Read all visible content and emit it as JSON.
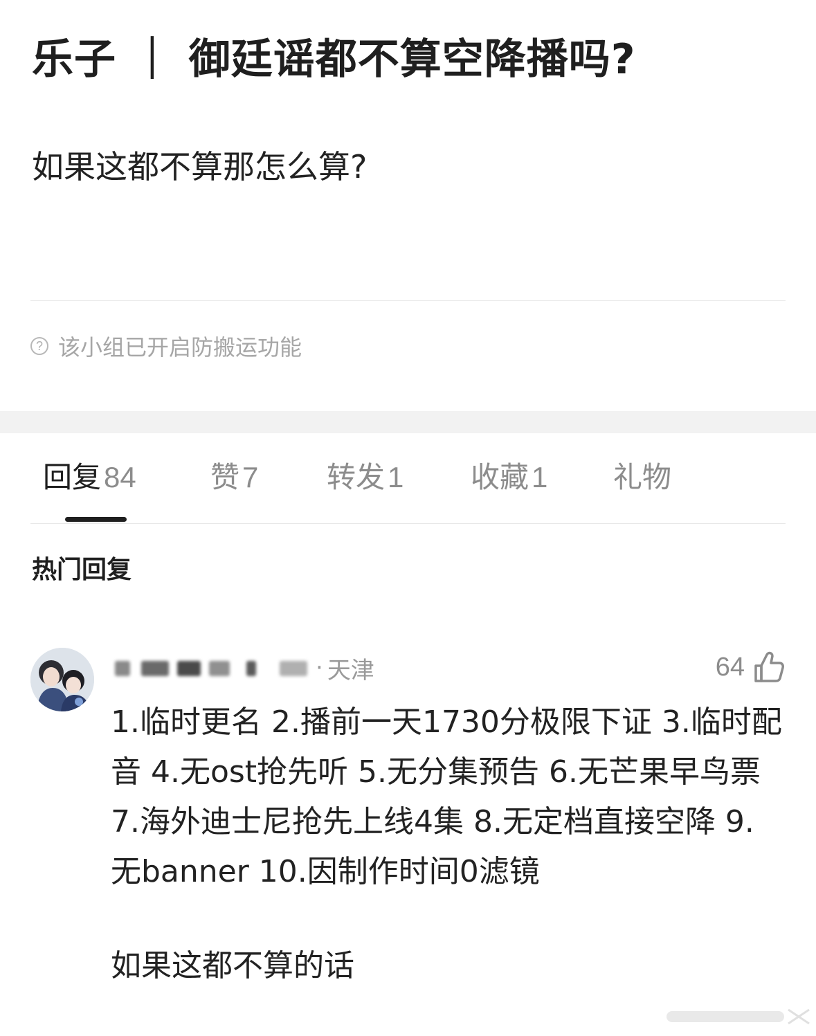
{
  "post": {
    "title": "乐子 ｜ 御廷谣都不算空降播吗?",
    "body": "如果这都不算那怎么算?",
    "notice": "该小组已开启防搬运功能",
    "notice_icon": "help-circle-icon"
  },
  "tabs": [
    {
      "label": "回复",
      "count": "84",
      "active": true
    },
    {
      "label": "赞",
      "count": "7",
      "active": false
    },
    {
      "label": "转发",
      "count": "1",
      "active": false
    },
    {
      "label": "收藏",
      "count": "1",
      "active": false
    },
    {
      "label": "礼物",
      "count": "",
      "active": false
    }
  ],
  "section_title": "热门回复",
  "comment": {
    "separator": "·",
    "location": "天津",
    "like_count": "64",
    "like_icon": "thumbs-up-icon",
    "text": "1.临时更名 2.播前一天1730分极限下证 3.临时配音 4.无ost抢先听 5.无分集预告 6.无芒果早鸟票 7.海外迪士尼抢先上线4集 8.无定档直接空降 9.无banner 10.因制作时间0滤镜",
    "tail": "如果这都不算的话"
  },
  "colors": {
    "text_primary": "#1f1f1f",
    "text_secondary": "#8c8c8c",
    "divider": "#e8e8e8",
    "section_band": "#f2f2f2"
  }
}
